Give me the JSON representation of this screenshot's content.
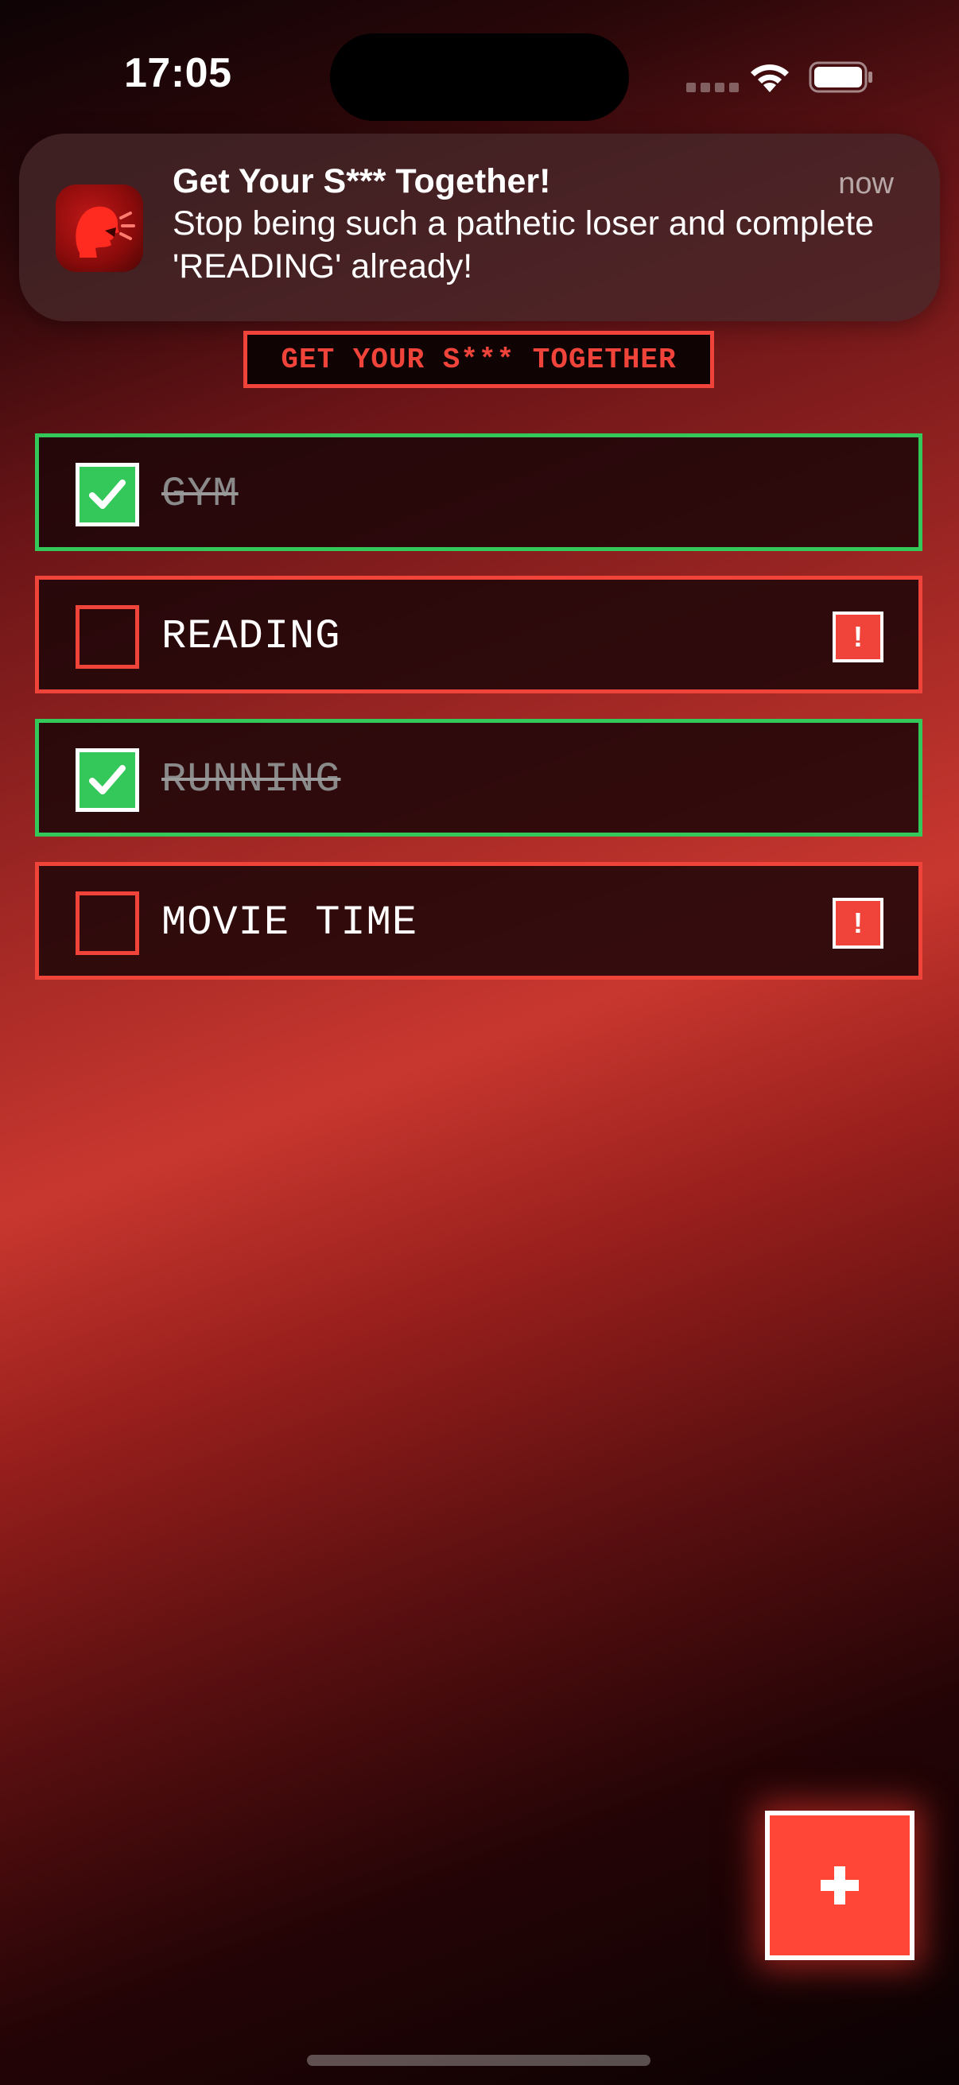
{
  "status_bar": {
    "time": "17:05"
  },
  "notification": {
    "app_icon": "screaming-head-icon",
    "title": "Get Your S*** Together!",
    "time": "now",
    "body": "Stop being such a pathetic loser and complete 'READING' already!"
  },
  "header": {
    "title": "GET YOUR S*** TOGETHER"
  },
  "tasks": [
    {
      "label": "GYM",
      "done": true
    },
    {
      "label": "READING",
      "done": false,
      "alert": "!"
    },
    {
      "label": "RUNNING",
      "done": true
    },
    {
      "label": "MOVIE TIME",
      "done": false,
      "alert": "!"
    }
  ],
  "add_button": {
    "icon": "plus-icon"
  },
  "colors": {
    "accent_red": "#f0433a",
    "done_green": "#34c759",
    "add_red": "#ff4637"
  }
}
